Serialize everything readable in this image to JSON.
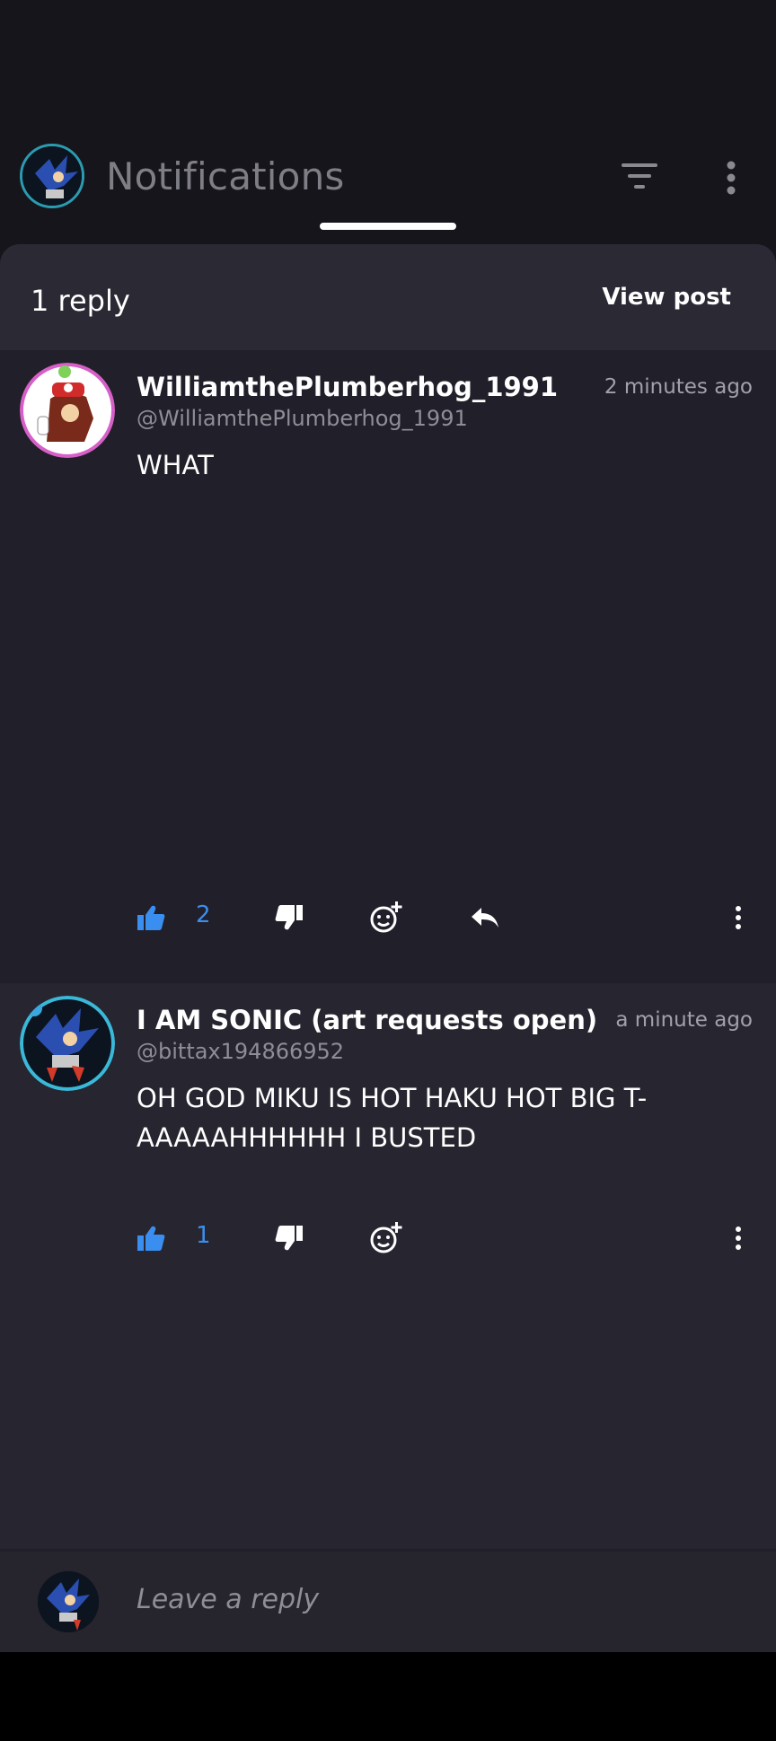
{
  "header": {
    "title": "Notifications",
    "icons": [
      "filter-icon",
      "more-vertical-icon"
    ]
  },
  "sheet": {
    "reply_count": "1 reply",
    "view_post": "View post"
  },
  "comments": [
    {
      "username": "WilliamthePlumberhog_1991",
      "handle": "@WilliamthePlumberhog_1991",
      "time": "2 minutes ago",
      "text": "WHAT",
      "likes": "2"
    },
    {
      "username": "I AM SONIC (art requests open)",
      "handle": "@bittax194866952",
      "time": "a minute ago",
      "text": "OH GOD MIKU IS HOT HAKU HOT BIG T-AAAAAHHHHHH I BUSTED",
      "likes": "1"
    }
  ],
  "reply_bar": {
    "placeholder": "Leave a reply"
  },
  "colors": {
    "accent_blue": "#3a8ef0",
    "sheet_bg": "#211f2a",
    "header_bg": "#2b2934"
  }
}
